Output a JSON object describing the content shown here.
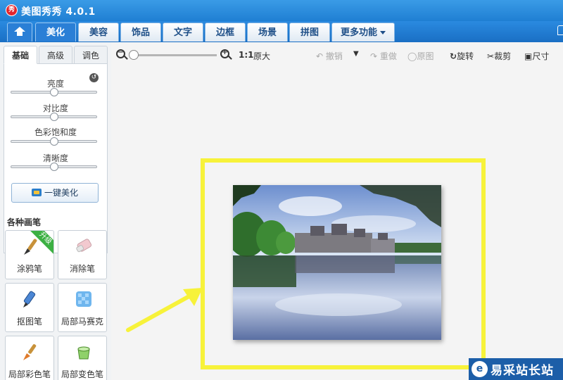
{
  "window": {
    "title": "美图秀秀 4.0.1",
    "logo_text": "秀"
  },
  "nav": {
    "tabs": [
      {
        "label": ""
      },
      {
        "label": "美化"
      },
      {
        "label": "美容"
      },
      {
        "label": "饰品"
      },
      {
        "label": "文字"
      },
      {
        "label": "边框"
      },
      {
        "label": "场景"
      },
      {
        "label": "拼图"
      },
      {
        "label": "更多功能"
      }
    ],
    "active": "美化"
  },
  "left_panel": {
    "sub_tabs": [
      {
        "label": "基础"
      },
      {
        "label": "高级"
      },
      {
        "label": "调色"
      }
    ],
    "active_sub_tab": "基础",
    "sliders": [
      {
        "label": "亮度",
        "value": 0.5
      },
      {
        "label": "对比度",
        "value": 0.5
      },
      {
        "label": "色彩饱和度",
        "value": 0.5
      },
      {
        "label": "清晰度",
        "value": 0.5
      }
    ],
    "one_key_label": "一键美化",
    "brushes_title": "各种画笔",
    "brushes": [
      {
        "label": "涂鸦笔",
        "badge": "升级"
      },
      {
        "label": "消除笔"
      },
      {
        "label": "抠图笔"
      },
      {
        "label": "局部马赛克"
      },
      {
        "label": "局部彩色笔"
      },
      {
        "label": "局部变色笔"
      }
    ]
  },
  "toolbar": {
    "zoom_value": 0.0,
    "actual_size_label": "1:1",
    "original_size_label": "原大",
    "undo": "撤销",
    "redo": "重做",
    "original": "原图",
    "rotate": "旋转",
    "crop": "裁剪",
    "size": "尺寸"
  },
  "watermark": {
    "logo": "e",
    "text": "易采站长站"
  },
  "colors": {
    "title_bar": "#1f7fd3",
    "highlight": "#f7f23a",
    "upgrade_badge": "#3cb043"
  }
}
